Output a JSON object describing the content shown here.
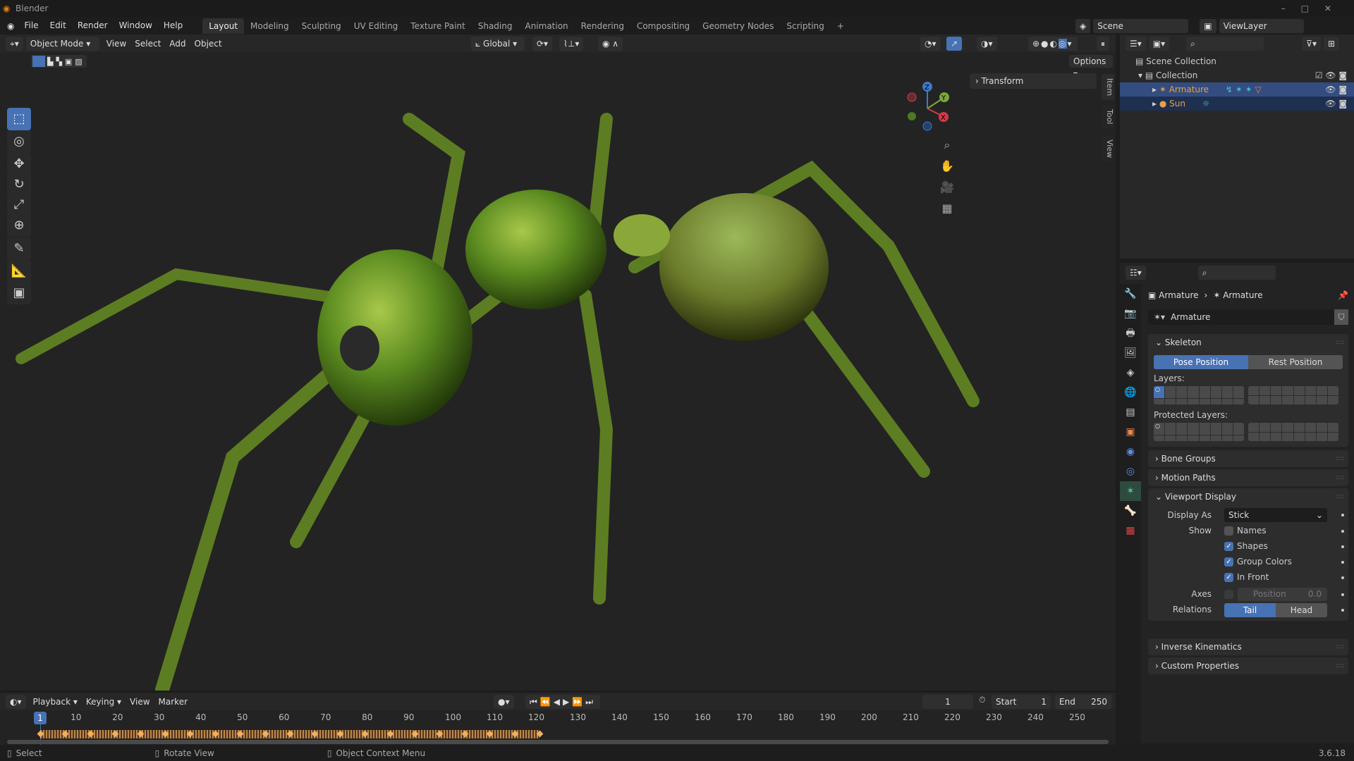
{
  "app": {
    "title": "Blender",
    "version": "3.6.18"
  },
  "menus": [
    "File",
    "Edit",
    "Render",
    "Window",
    "Help"
  ],
  "workspaces": [
    "Layout",
    "Modeling",
    "Sculpting",
    "UV Editing",
    "Texture Paint",
    "Shading",
    "Animation",
    "Rendering",
    "Compositing",
    "Geometry Nodes",
    "Scripting",
    "+"
  ],
  "scene": {
    "name": "Scene",
    "view_layer": "ViewLayer"
  },
  "viewport": {
    "mode": "Object Mode",
    "menus": [
      "View",
      "Select",
      "Add",
      "Object"
    ],
    "orientation": "Global",
    "options": "Options",
    "npanel": {
      "transform": "Transform",
      "tabs": [
        "Item",
        "Tool",
        "View"
      ]
    },
    "gizmo": {
      "x": "X",
      "y": "Y",
      "z": "Z"
    },
    "tools": [
      "select-box",
      "cursor",
      "move",
      "rotate",
      "scale",
      "transform",
      "annotate",
      "measure",
      "add-cube"
    ]
  },
  "outliner": {
    "scene_collection": "Scene Collection",
    "collection": "Collection",
    "items": [
      {
        "name": "Armature",
        "color": "#e8a04a"
      },
      {
        "name": "Sun",
        "color": "#e8a04a"
      }
    ]
  },
  "properties": {
    "breadcrumb": [
      "Armature",
      "Armature"
    ],
    "data_name": "Armature",
    "skeleton": {
      "title": "Skeleton",
      "pose": "Pose Position",
      "rest": "Rest Position",
      "layers": "Layers:",
      "protected": "Protected Layers:"
    },
    "collapsed": [
      "Bone Groups",
      "Motion Paths"
    ],
    "viewport_display": {
      "title": "Viewport Display",
      "display_as_label": "Display As",
      "display_as": "Stick",
      "show_label": "Show",
      "names": "Names",
      "shapes": "Shapes",
      "group_colors": "Group Colors",
      "in_front": "In Front",
      "axes_label": "Axes",
      "position_label": "Position",
      "position_value": "0.0",
      "relations_label": "Relations",
      "tail": "Tail",
      "head": "Head",
      "checks": {
        "names": false,
        "shapes": true,
        "group_colors": true,
        "in_front": true,
        "axes": false
      }
    },
    "collapsed2": [
      "Inverse Kinematics",
      "Custom Properties"
    ]
  },
  "timeline": {
    "menus": [
      "Playback",
      "Keying",
      "View",
      "Marker"
    ],
    "current": "1",
    "start_label": "Start",
    "start": "1",
    "end_label": "End",
    "end": "250",
    "ticks": [
      "10",
      "20",
      "30",
      "40",
      "50",
      "60",
      "70",
      "80",
      "90",
      "100",
      "110",
      "120",
      "130",
      "140",
      "150",
      "160",
      "170",
      "180",
      "190",
      "200",
      "210",
      "220",
      "230",
      "240",
      "250"
    ],
    "current_frame_marker": "1",
    "keyframes_end": 121
  },
  "status": {
    "select": "Select",
    "rotate": "Rotate View",
    "context": "Object Context Menu"
  },
  "colors": {
    "accent": "#4772b3",
    "ant": "#6f9a2a"
  }
}
